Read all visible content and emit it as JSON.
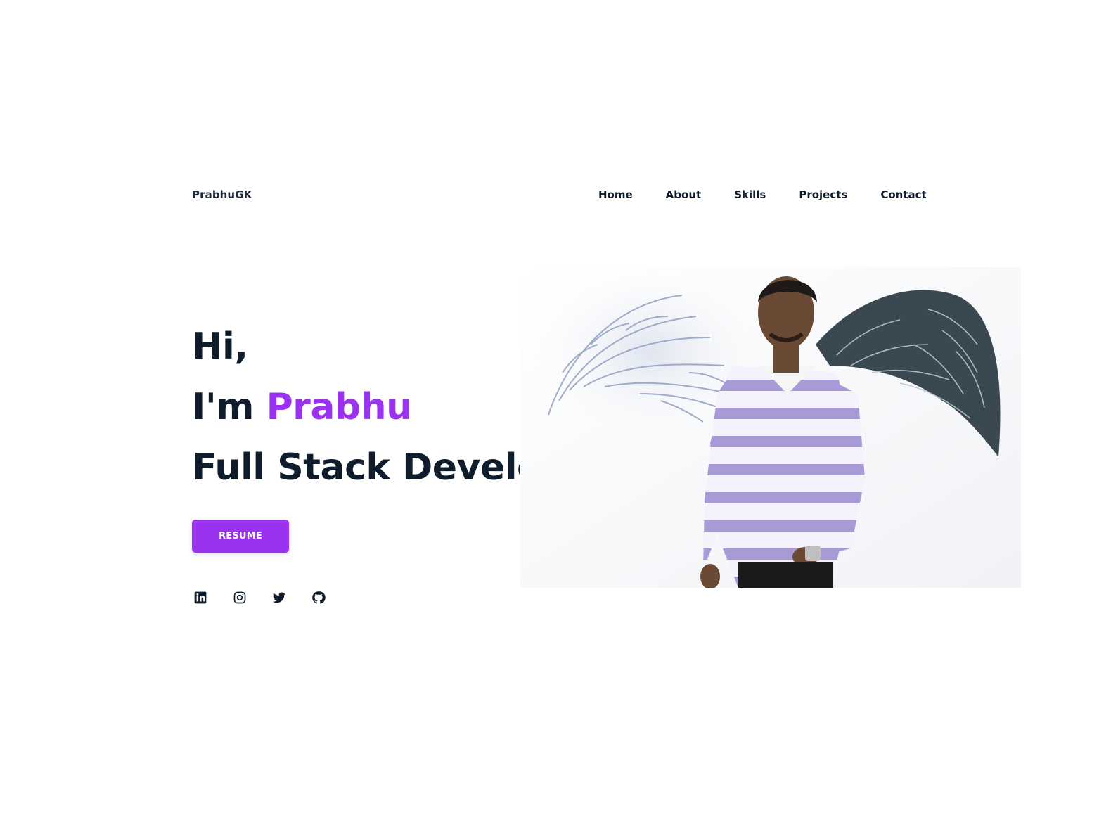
{
  "header": {
    "logo": "PrabhuGK",
    "nav": [
      {
        "label": "Home"
      },
      {
        "label": "About"
      },
      {
        "label": "Skills"
      },
      {
        "label": "Projects"
      },
      {
        "label": "Contact"
      }
    ]
  },
  "hero": {
    "greeting": "Hi,",
    "intro_prefix": "I'm ",
    "name": "Prabhu",
    "role": "Full Stack Developer",
    "resume_label": "RESUME",
    "accent_color": "#9a32f0",
    "text_color": "#0f1c2c"
  },
  "socials": [
    {
      "icon": "linkedin-icon"
    },
    {
      "icon": "instagram-icon"
    },
    {
      "icon": "twitter-icon"
    },
    {
      "icon": "github-icon"
    }
  ]
}
